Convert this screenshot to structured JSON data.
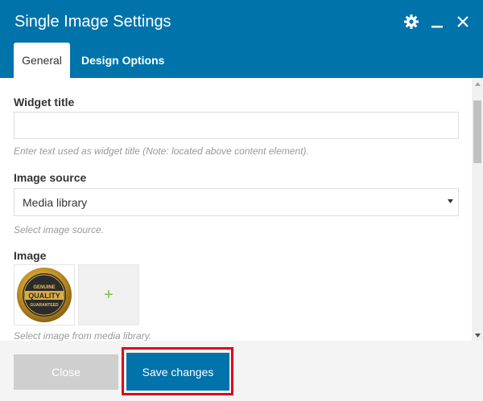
{
  "dialog": {
    "title": "Single Image Settings"
  },
  "header_icons": [
    "gear-icon",
    "minimize-icon",
    "close-icon"
  ],
  "tabs": [
    {
      "label": "General",
      "active": true
    },
    {
      "label": "Design Options",
      "active": false
    }
  ],
  "fields": {
    "widget_title": {
      "label": "Widget title",
      "value": "",
      "help": "Enter text used as widget title (Note: located above content element)."
    },
    "image_source": {
      "label": "Image source",
      "value": "Media library",
      "help": "Select image source."
    },
    "image": {
      "label": "Image",
      "add_label": "+",
      "help": "Select image from media library."
    }
  },
  "badge": {
    "top": "GENUINE",
    "middle": "QUALITY",
    "bottom": "GUARANTEED"
  },
  "footer": {
    "close_label": "Close",
    "save_label": "Save changes"
  },
  "colors": {
    "header": "#0073aa",
    "save": "#0073aa",
    "close": "#cfcfcf",
    "highlight": "#e3001b",
    "plus": "#7ac143"
  }
}
